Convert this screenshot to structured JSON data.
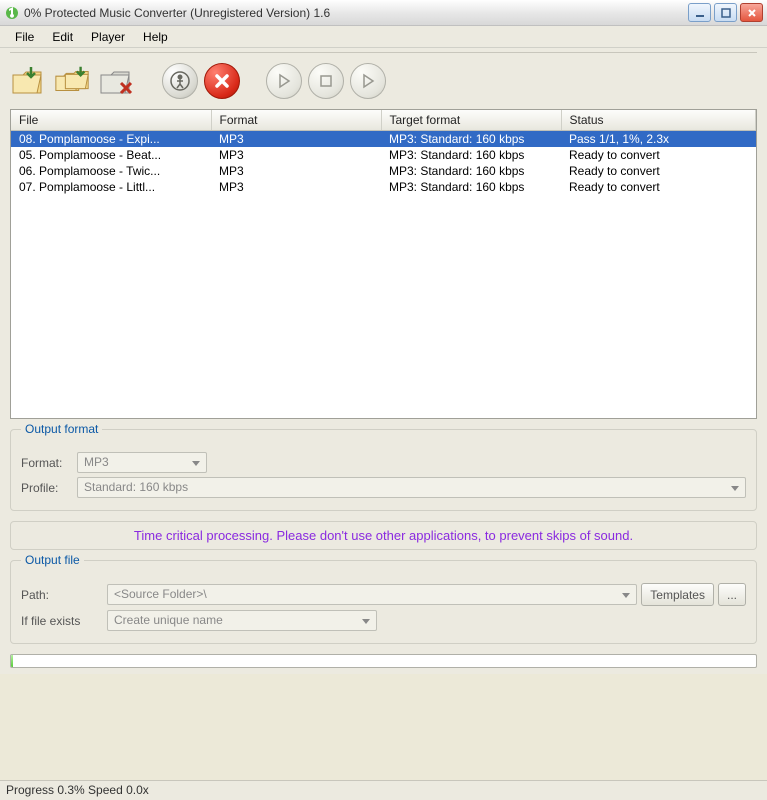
{
  "window": {
    "title": "0% Protected Music Converter  (Unregistered Version) 1.6"
  },
  "menu": {
    "file": "File",
    "edit": "Edit",
    "player": "Player",
    "help": "Help"
  },
  "columns": {
    "file": "File",
    "format": "Format",
    "target": "Target format",
    "status": "Status"
  },
  "rows": [
    {
      "file": "08. Pomplamoose - Expi...",
      "format": "MP3",
      "target": "MP3: Standard: 160 kbps",
      "status": "Pass 1/1, 1%, 2.3x",
      "selected": true
    },
    {
      "file": "05. Pomplamoose - Beat...",
      "format": "MP3",
      "target": "MP3: Standard: 160 kbps",
      "status": "Ready to convert",
      "selected": false
    },
    {
      "file": "06. Pomplamoose - Twic...",
      "format": "MP3",
      "target": "MP3: Standard: 160 kbps",
      "status": "Ready to convert",
      "selected": false
    },
    {
      "file": "07. Pomplamoose - Littl...",
      "format": "MP3",
      "target": "MP3: Standard: 160 kbps",
      "status": "Ready to convert",
      "selected": false
    }
  ],
  "output_format": {
    "title": "Output format",
    "format_label": "Format:",
    "format_value": "MP3",
    "profile_label": "Profile:",
    "profile_value": "Standard: 160 kbps"
  },
  "warning": "Time critical processing. Please don't use other applications, to prevent skips of sound.",
  "output_file": {
    "title": "Output file",
    "path_label": "Path:",
    "path_value": "<Source Folder>\\",
    "templates_btn": "Templates",
    "browse_btn": "...",
    "exists_label": "If file exists",
    "exists_value": "Create unique name"
  },
  "statusbar": "Progress 0.3% Speed 0.0x"
}
